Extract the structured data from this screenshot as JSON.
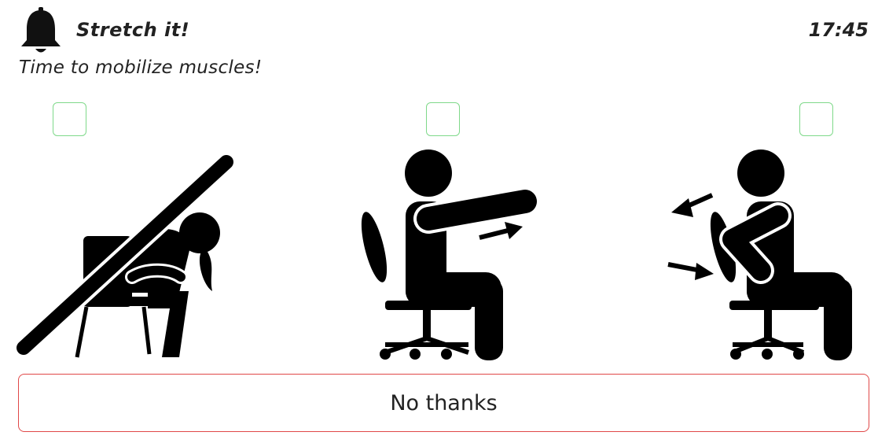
{
  "header": {
    "title": "Stretch it!",
    "time": "17:45",
    "subtitle": "Time to mobilize muscles!",
    "icon": "bell-icon"
  },
  "exercises": [
    {
      "icon": "side-bend-stretch-figure",
      "checked": false
    },
    {
      "icon": "arm-extension-stretch-figure",
      "checked": false
    },
    {
      "icon": "chest-hug-stretch-figure",
      "checked": false
    }
  ],
  "actions": {
    "decline_label": "No thanks"
  },
  "colors": {
    "checkbox_border": "#7fd98a",
    "decline_border": "#e04848",
    "ink": "#000000"
  }
}
